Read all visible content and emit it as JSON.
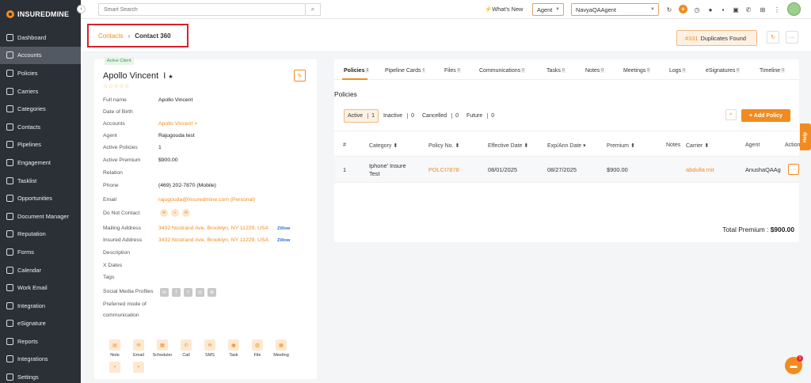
{
  "app": {
    "logo": "INSUREDMINE"
  },
  "sidebar": {
    "items": [
      {
        "label": "Dashboard"
      },
      {
        "label": "Accounts"
      },
      {
        "label": "Policies"
      },
      {
        "label": "Carriers"
      },
      {
        "label": "Categories"
      },
      {
        "label": "Contacts"
      },
      {
        "label": "Pipelines"
      },
      {
        "label": "Engagement"
      },
      {
        "label": "Tasklist"
      },
      {
        "label": "Opportunities"
      },
      {
        "label": "Document Manager"
      },
      {
        "label": "Reputation"
      },
      {
        "label": "Forms"
      },
      {
        "label": "Calendar"
      },
      {
        "label": "Work Email"
      },
      {
        "label": "Integration"
      },
      {
        "label": "eSignature"
      },
      {
        "label": "Reports"
      },
      {
        "label": "Integrations"
      },
      {
        "label": "Settings"
      }
    ]
  },
  "topbar": {
    "search_placeholder": "Smart Search",
    "whats_new": "What's New",
    "role": "Agent",
    "agent": "NavyaQAAgent"
  },
  "breadcrumb": {
    "parent": "Contacts",
    "separator": "›",
    "current": "Contact 360"
  },
  "duplicates": {
    "count": "#331",
    "label": "Duplicates Found"
  },
  "contact": {
    "badge": "Active Client",
    "name": "Apollo Vincent",
    "initial": "I",
    "fields": [
      {
        "label": "Full name",
        "value": "Apollo Vincent"
      },
      {
        "label": "Date of Birth",
        "value": ""
      },
      {
        "label": "Accounts",
        "value": "Apollo Vincent >"
      },
      {
        "label": "Agent",
        "value": "Rajugouda test"
      },
      {
        "label": "Active Policies",
        "value": "1"
      },
      {
        "label": "Active Premium",
        "value": "$900.00"
      },
      {
        "label": "Relation",
        "value": ""
      },
      {
        "label": "Phone",
        "value": "(469) 202-7870 (Mobile)"
      },
      {
        "label": "Email",
        "value": "rajugouda@insuredmine.com  (Personal)"
      },
      {
        "label": "Do Not Contact",
        "value": ""
      },
      {
        "label": "Mailing Address",
        "value": "3432 Nostrand Ave, Brooklyn, NY 11229, USA"
      },
      {
        "label": "Insured Address",
        "value": "3432 Nostrand Ave, Brooklyn, NY 11229, USA"
      },
      {
        "label": "Description",
        "value": ""
      },
      {
        "label": "X Dates",
        "value": ""
      },
      {
        "label": "Tags",
        "value": ""
      },
      {
        "label": "Social Media Profiles",
        "value": ""
      },
      {
        "label": "Preferred mode of",
        "value": ""
      },
      {
        "label": "communication",
        "value": ""
      }
    ],
    "zillow": "Zillow",
    "actions": [
      {
        "label": "Note"
      },
      {
        "label": "Email"
      },
      {
        "label": "Scheduler"
      },
      {
        "label": "Call"
      },
      {
        "label": "SMS"
      },
      {
        "label": "Task"
      },
      {
        "label": "File"
      },
      {
        "label": "Meeting"
      }
    ]
  },
  "tabs": [
    {
      "label": "Policies",
      "count": "1"
    },
    {
      "label": "Pipeline Cards",
      "count": "1"
    },
    {
      "label": "Files",
      "count": "0"
    },
    {
      "label": "Communications",
      "count": "0"
    },
    {
      "label": "Tasks",
      "count": "0"
    },
    {
      "label": "Notes",
      "count": "0"
    },
    {
      "label": "Meetings",
      "count": "0"
    },
    {
      "label": "Logs",
      "count": "0"
    },
    {
      "label": "eSignatures",
      "count": "0"
    },
    {
      "label": "Timeline",
      "count": "0"
    }
  ],
  "policies": {
    "title": "Policies",
    "filters": [
      {
        "label": "Active",
        "count": "1"
      },
      {
        "label": "Inactive",
        "count": "0"
      },
      {
        "label": "Cancelled",
        "count": "0"
      },
      {
        "label": "Future",
        "count": "0"
      }
    ],
    "add_label": "+ Add Policy",
    "columns": [
      "#",
      "Category ⬍",
      "Policy No. ⬍",
      "Effective Date ⬍",
      "Exp/Ann Date ▾",
      "Premium ⬍",
      "Notes",
      "Carrier ⬍",
      "Agent",
      "Actions"
    ],
    "row": {
      "num": "1",
      "category1": "Iphone' Insure",
      "category2": "Test",
      "policy_no": "POLCI7878",
      "effective": "08/01/2025",
      "exp": "08/27/2025",
      "premium": "$900.00",
      "carrier": "abdulla mir",
      "agent": "AnushaQAAg"
    },
    "total_label": "Total Premium :",
    "total_value": "$900.00"
  },
  "help": "Help",
  "chat_badge": "1"
}
